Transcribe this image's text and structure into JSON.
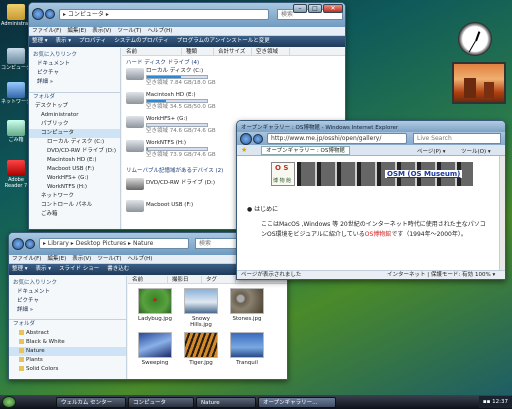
{
  "desktop": {
    "icons": [
      "Administrator",
      "コンピュータ",
      "ネットワーク",
      "ごみ箱",
      "Adobe Reader 7"
    ]
  },
  "explorer": {
    "address": "▸ コンピュータ ▸",
    "search_placeholder": "検索",
    "menu": [
      "ファイル(F)",
      "編集(E)",
      "表示(V)",
      "ツール(T)",
      "ヘルプ(H)"
    ],
    "toolbar": [
      "整理 ▾",
      "表示 ▾",
      "プロパティ",
      "システムのプロパティ",
      "プログラムのアンインストールと変更"
    ],
    "fav_header": "お気に入りリンク",
    "fav": [
      "ドキュメント",
      "ピクチャ",
      "詳細 »"
    ],
    "folder_header": "フォルダ",
    "tree": [
      "デスクトップ",
      "Administrator",
      "パブリック",
      "コンピュータ",
      "ローカル ディスク (C:)",
      "DVD/CD-RW ドライブ (D:)",
      "Macintosh HD (E:)",
      "Macboot USB (F:)",
      "WorkHFS+ (G:)",
      "WorkNTFS (H:)",
      "ネットワーク",
      "コントロール パネル",
      "ごみ箱"
    ],
    "cols": [
      "名前",
      "種類",
      "合計サイズ",
      "空き領域"
    ],
    "section_hdd": "ハード ディスク ドライブ (4)",
    "drives": [
      {
        "name": "ローカル ディスク (C:)",
        "free": "空き領域 7.84 GB/18.0 GB",
        "used": 0.56
      },
      {
        "name": "Macintosh HD (E:)",
        "free": "空き領域 34.5 GB/50.0 GB",
        "used": 0.31
      },
      {
        "name": "WorkHFS+ (G:)",
        "free": "空き領域 74.6 GB/74.6 GB",
        "used": 0.0
      },
      {
        "name": "WorkNTFS (H:)",
        "free": "空き領域 73.9 GB/74.6 GB",
        "used": 0.01
      }
    ],
    "section_removable": "リムーバブル記憶域があるデバイス (2)",
    "removables": [
      "DVD/CD-RW ドライブ (D:)",
      "Macboot USB (F:)"
    ]
  },
  "pictures": {
    "address": "▸ Library ▸ Desktop Pictures ▸ Nature",
    "search_placeholder": "検索",
    "menu": [
      "ファイル(F)",
      "編集(E)",
      "表示(V)",
      "ツール(T)",
      "ヘルプ(H)"
    ],
    "toolbar": [
      "整理 ▾",
      "表示 ▾",
      "スライド ショー",
      "書き込む"
    ],
    "fav_header": "お気に入りリンク",
    "fav": [
      "ドキュメント",
      "ピクチャ",
      "詳細 »"
    ],
    "folder_header": "フォルダ",
    "folders": [
      "Abstract",
      "Black & White",
      "Nature",
      "Plants",
      "Solid Colors"
    ],
    "cols": [
      "名前",
      "撮影日",
      "タグ"
    ],
    "thumbs": [
      "Ladybug.jpg",
      "Snowy Hills.jpg",
      "Stones.jpg",
      "Sweeping",
      "Tiger.jpg",
      "Tranquil"
    ]
  },
  "ie": {
    "title": "オープンギャラリー : OS博物館 - Windows Internet Explorer",
    "url": "http://www.me.jp/osshi/open/gallery/",
    "search_placeholder": "Live Search",
    "tab": "オープンギャラリー : OS博物館",
    "cmd": [
      "ページ(P) ▾",
      "ツール(O) ▾"
    ],
    "logo_top": "O S",
    "logo_bottom": "博 物 館",
    "logo_name": "OSM (OS Museum)",
    "bullet": "はじめに",
    "para_a": "ここはMacOS ,Windows 等 20世紀のインターネット時代に使用された主なパソコンOS環境をビジュアルに紹介している",
    "para_link": "OS博物館",
    "para_b": "です（1994年～2000年）。",
    "status": "ページが表示されました",
    "zone": "インターネット | 保護モード: 有効",
    "zoom": "100% ▾"
  },
  "taskbar": {
    "items": [
      "ウェルカム センター",
      "コンピュータ",
      "Nature",
      "オープンギャラリー..."
    ],
    "active": 3,
    "time": "12:37"
  },
  "colors": {
    "accent": "#2a8ad8",
    "taskbar": "#1a2230",
    "logo_blue": "#1a3a9a"
  }
}
